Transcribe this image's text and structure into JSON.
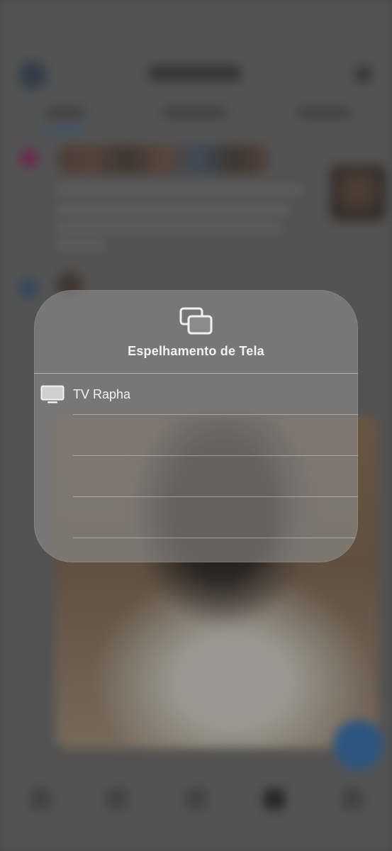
{
  "panel": {
    "title": "Espelhamento de Tela",
    "icon": "screen-mirroring-icon",
    "devices": [
      {
        "label": "TV Rapha",
        "icon": "tv-icon"
      }
    ],
    "empty_rows": 3
  },
  "colors": {
    "panel_bg": "#969696",
    "text": "#f2f2f2",
    "separator": "#e6e6e6"
  }
}
